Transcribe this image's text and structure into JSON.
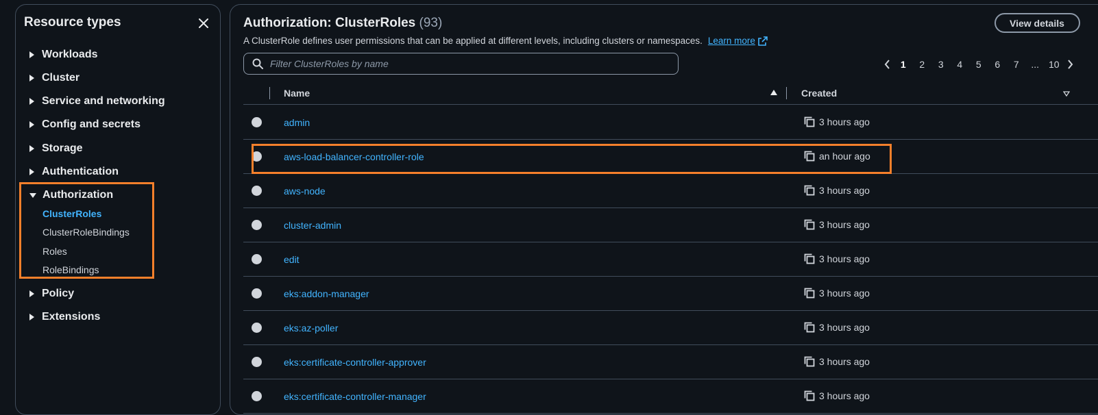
{
  "sidebar": {
    "title": "Resource types",
    "items": [
      {
        "label": "Workloads"
      },
      {
        "label": "Cluster"
      },
      {
        "label": "Service and networking"
      },
      {
        "label": "Config and secrets"
      },
      {
        "label": "Storage"
      },
      {
        "label": "Authentication"
      },
      {
        "label": "Authorization"
      },
      {
        "label": "Policy"
      },
      {
        "label": "Extensions"
      }
    ],
    "authorization_children": [
      {
        "label": "ClusterRoles"
      },
      {
        "label": "ClusterRoleBindings"
      },
      {
        "label": "Roles"
      },
      {
        "label": "RoleBindings"
      }
    ]
  },
  "header": {
    "title": "Authorization: ClusterRoles",
    "count": "(93)",
    "description": "A ClusterRole defines user permissions that can be applied at different levels, including clusters or namespaces.",
    "learn_more": "Learn more",
    "view_details": "View details"
  },
  "search": {
    "placeholder": "Filter ClusterRoles by name"
  },
  "pagination": {
    "pages": [
      "1",
      "2",
      "3",
      "4",
      "5",
      "6",
      "7",
      "...",
      "10"
    ],
    "current": "1"
  },
  "table": {
    "columns": {
      "name": "Name",
      "created": "Created"
    },
    "rows": [
      {
        "name": "admin",
        "created": "3 hours ago"
      },
      {
        "name": "aws-load-balancer-controller-role",
        "created": "an hour ago"
      },
      {
        "name": "aws-node",
        "created": "3 hours ago"
      },
      {
        "name": "cluster-admin",
        "created": "3 hours ago"
      },
      {
        "name": "edit",
        "created": "3 hours ago"
      },
      {
        "name": "eks:addon-manager",
        "created": "3 hours ago"
      },
      {
        "name": "eks:az-poller",
        "created": "3 hours ago"
      },
      {
        "name": "eks:certificate-controller-approver",
        "created": "3 hours ago"
      },
      {
        "name": "eks:certificate-controller-manager",
        "created": "3 hours ago"
      }
    ]
  },
  "colors": {
    "background": "#0f141a",
    "link": "#42b4ff",
    "highlight": "#f6802b",
    "border": "#414d5c"
  }
}
